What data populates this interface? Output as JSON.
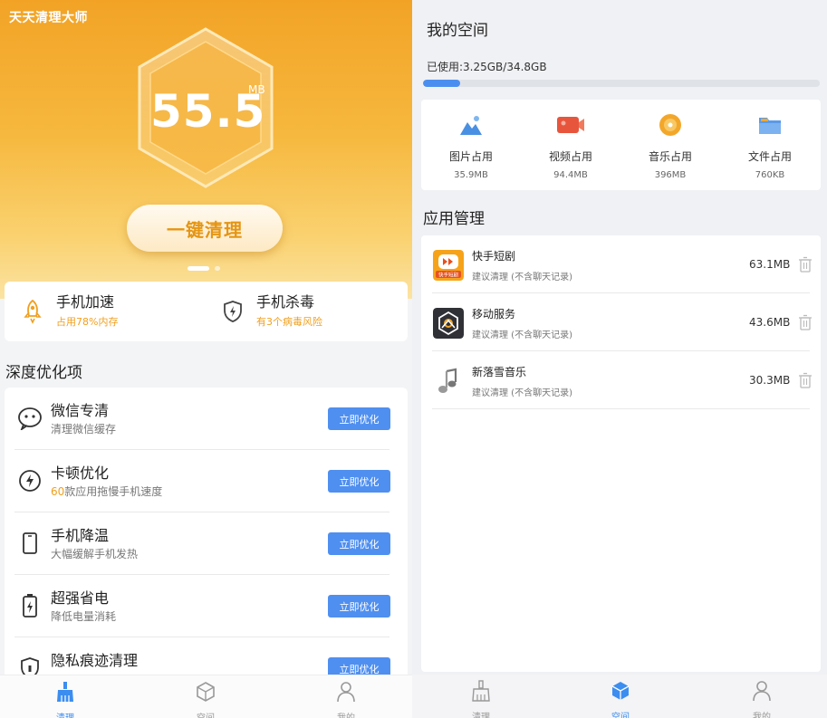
{
  "left": {
    "app_title": "天天清理大师",
    "junk": {
      "value": "55.5",
      "unit": "MB"
    },
    "clean_button": "一键清理",
    "quick": [
      {
        "title": "手机加速",
        "sub": "占用78%内存",
        "icon": "rocket-icon"
      },
      {
        "title": "手机杀毒",
        "sub": "有3个病毒风险",
        "icon": "shield-icon"
      }
    ],
    "section_title": "深度优化项",
    "opt_items": [
      {
        "title": "微信专清",
        "sub": "清理微信缓存",
        "icon": "wechat-icon",
        "button": "立即优化"
      },
      {
        "title": "卡顿优化",
        "sub_highlight": "60",
        "sub": "款应用拖慢手机速度",
        "icon": "speed-icon",
        "button": "立即优化"
      },
      {
        "title": "手机降温",
        "sub": "大幅缓解手机发热",
        "icon": "phone-icon",
        "button": "立即优化"
      },
      {
        "title": "超强省电",
        "sub": "降低电量消耗",
        "icon": "battery-icon",
        "button": "立即优化"
      },
      {
        "title": "隐私痕迹清理",
        "sub": "",
        "icon": "privacy-icon",
        "button": "立即优化"
      }
    ],
    "tabs": [
      {
        "label": "清理",
        "icon": "broom-icon",
        "active": true
      },
      {
        "label": "空间",
        "icon": "cube-icon",
        "active": false
      },
      {
        "label": "我的",
        "icon": "user-icon",
        "active": false
      }
    ]
  },
  "right": {
    "header": "我的空间",
    "used": {
      "label": "已使用:3.25GB/34.8GB",
      "fraction": 0.093
    },
    "media": [
      {
        "label": "图片占用",
        "size": "35.9MB",
        "icon": "picture-icon"
      },
      {
        "label": "视频占用",
        "size": "94.4MB",
        "icon": "video-icon"
      },
      {
        "label": "音乐占用",
        "size": "396MB",
        "icon": "music-icon"
      },
      {
        "label": "文件占用",
        "size": "760KB",
        "icon": "folder-icon"
      }
    ],
    "apps_title": "应用管理",
    "apps": [
      {
        "name": "快手短剧",
        "note": "建议清理 (不含聊天记录)",
        "size": "63.1MB",
        "icon": "kuaishou-app-icon",
        "icon_text": "快手短剧"
      },
      {
        "name": "移动服务",
        "note": "建议清理 (不含聊天记录)",
        "size": "43.6MB",
        "icon": "mobile-service-app-icon"
      },
      {
        "name": "新落雪音乐",
        "note": "建议清理 (不含聊天记录)",
        "size": "30.3MB",
        "icon": "music-app-icon"
      }
    ],
    "tabs": [
      {
        "label": "清理",
        "icon": "broom-icon",
        "active": false
      },
      {
        "label": "空间",
        "icon": "cube-icon",
        "active": true
      },
      {
        "label": "我的",
        "icon": "user-icon",
        "active": false
      }
    ]
  },
  "colors": {
    "accent": "#4f8ff0",
    "orange": "#f0a020",
    "hero_top": "#f2a326",
    "hero_bottom": "#fbe3a2"
  }
}
